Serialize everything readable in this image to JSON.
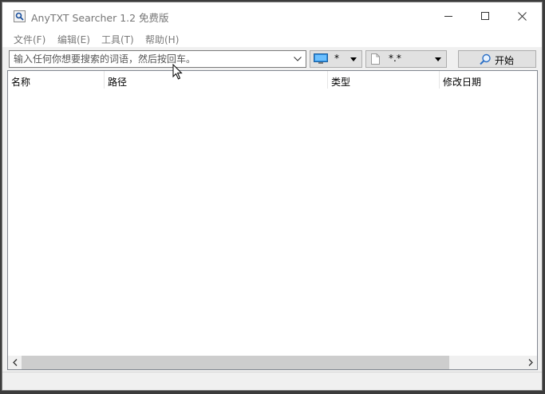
{
  "window": {
    "title": "AnyTXT Searcher 1.2 免费版"
  },
  "menu": {
    "items": [
      "文件(F)",
      "编辑(E)",
      "工具(T)",
      "帮助(H)"
    ]
  },
  "toolbar": {
    "search_placeholder": "输入任何你想要搜索的词语，然后按回车。",
    "location_value": "*",
    "filetype_value": "*.*",
    "start_label": "开始"
  },
  "list": {
    "columns": [
      "名称",
      "路径",
      "类型",
      "修改日期"
    ]
  },
  "icons": {
    "app": "search-document-icon",
    "minimize": "minimize-icon",
    "maximize": "maximize-icon",
    "close": "close-icon",
    "location": "computer-icon",
    "filetype": "file-icon",
    "start": "search-icon"
  },
  "colors": {
    "title_text": "#767676",
    "menu_text": "#7a7a7a",
    "button_face": "#e1e1e1"
  }
}
